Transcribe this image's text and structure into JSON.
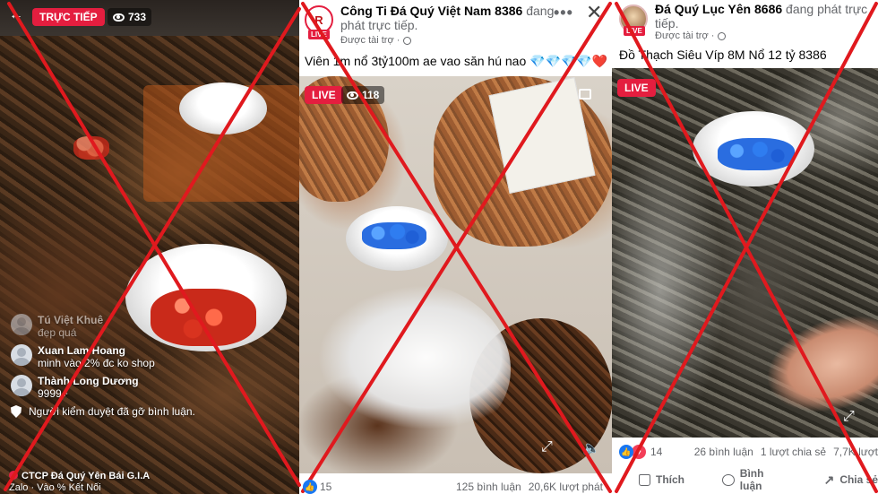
{
  "live_stream": {
    "live_label": "TRỰC TIẾP",
    "viewer_count": "733",
    "comments": [
      {
        "name": "Tú Việt Khuê",
        "text": "đẹp quá"
      },
      {
        "name": "Xuan Lam Hoang",
        "text": "minh vào 2% đc ko shop"
      },
      {
        "name": "Thành Long Dương",
        "text": "9999+"
      }
    ],
    "moderation_notice": "Người kiểm duyệt đã gỡ bình luận.",
    "bottom_name": "CTCP Đá Quý Yên Bái G.I.A",
    "bottom_text": "Zalo ·       Vào % Kết Nối"
  },
  "post_2": {
    "avatar_letter": "R",
    "live_badge": "LIVE",
    "page_name": "Công Ti Đá Quý Việt Nam 8386",
    "status_text": "đang phát trực tiếp.",
    "sponsored": "Được tài trợ ·",
    "caption": "Viên 1m nổ 3tỷ100m ae vao săn hú nao 💎💎💎💎❤️",
    "video_live_label": "LIVE",
    "video_viewers": "118",
    "reaction_count": "15",
    "comments_count": "125 bình luận",
    "views_count": "20,6K lượt phát"
  },
  "post_3": {
    "live_badge": "LIVE",
    "page_name": "Đá Quý Lục Yên 8686",
    "status_text": "đang phát trực tiếp.",
    "sponsored": "Được tài trợ ·",
    "caption": "Đồ Thạch Siêu Víp 8M Nổ 12 tỷ 8386",
    "video_live_label": "LIVE",
    "reaction_count": "14",
    "comments_count": "26 bình luận",
    "shares_count": "1 lượt chia sẻ",
    "views_count": "7,7K lượt",
    "actions": {
      "like": "Thích",
      "comment": "Bình luận",
      "share": "Chia sẻ"
    }
  },
  "colors": {
    "live_red": "#e41e3f",
    "x_overlay": "#e0191e",
    "fb_blue": "#1877f2"
  },
  "icons": [
    "back-arrow-icon",
    "eye-icon",
    "shield-icon",
    "globe-icon",
    "more-icon",
    "close-icon",
    "expand-icon",
    "volume-icon",
    "like-icon",
    "comment-icon",
    "share-icon"
  ]
}
